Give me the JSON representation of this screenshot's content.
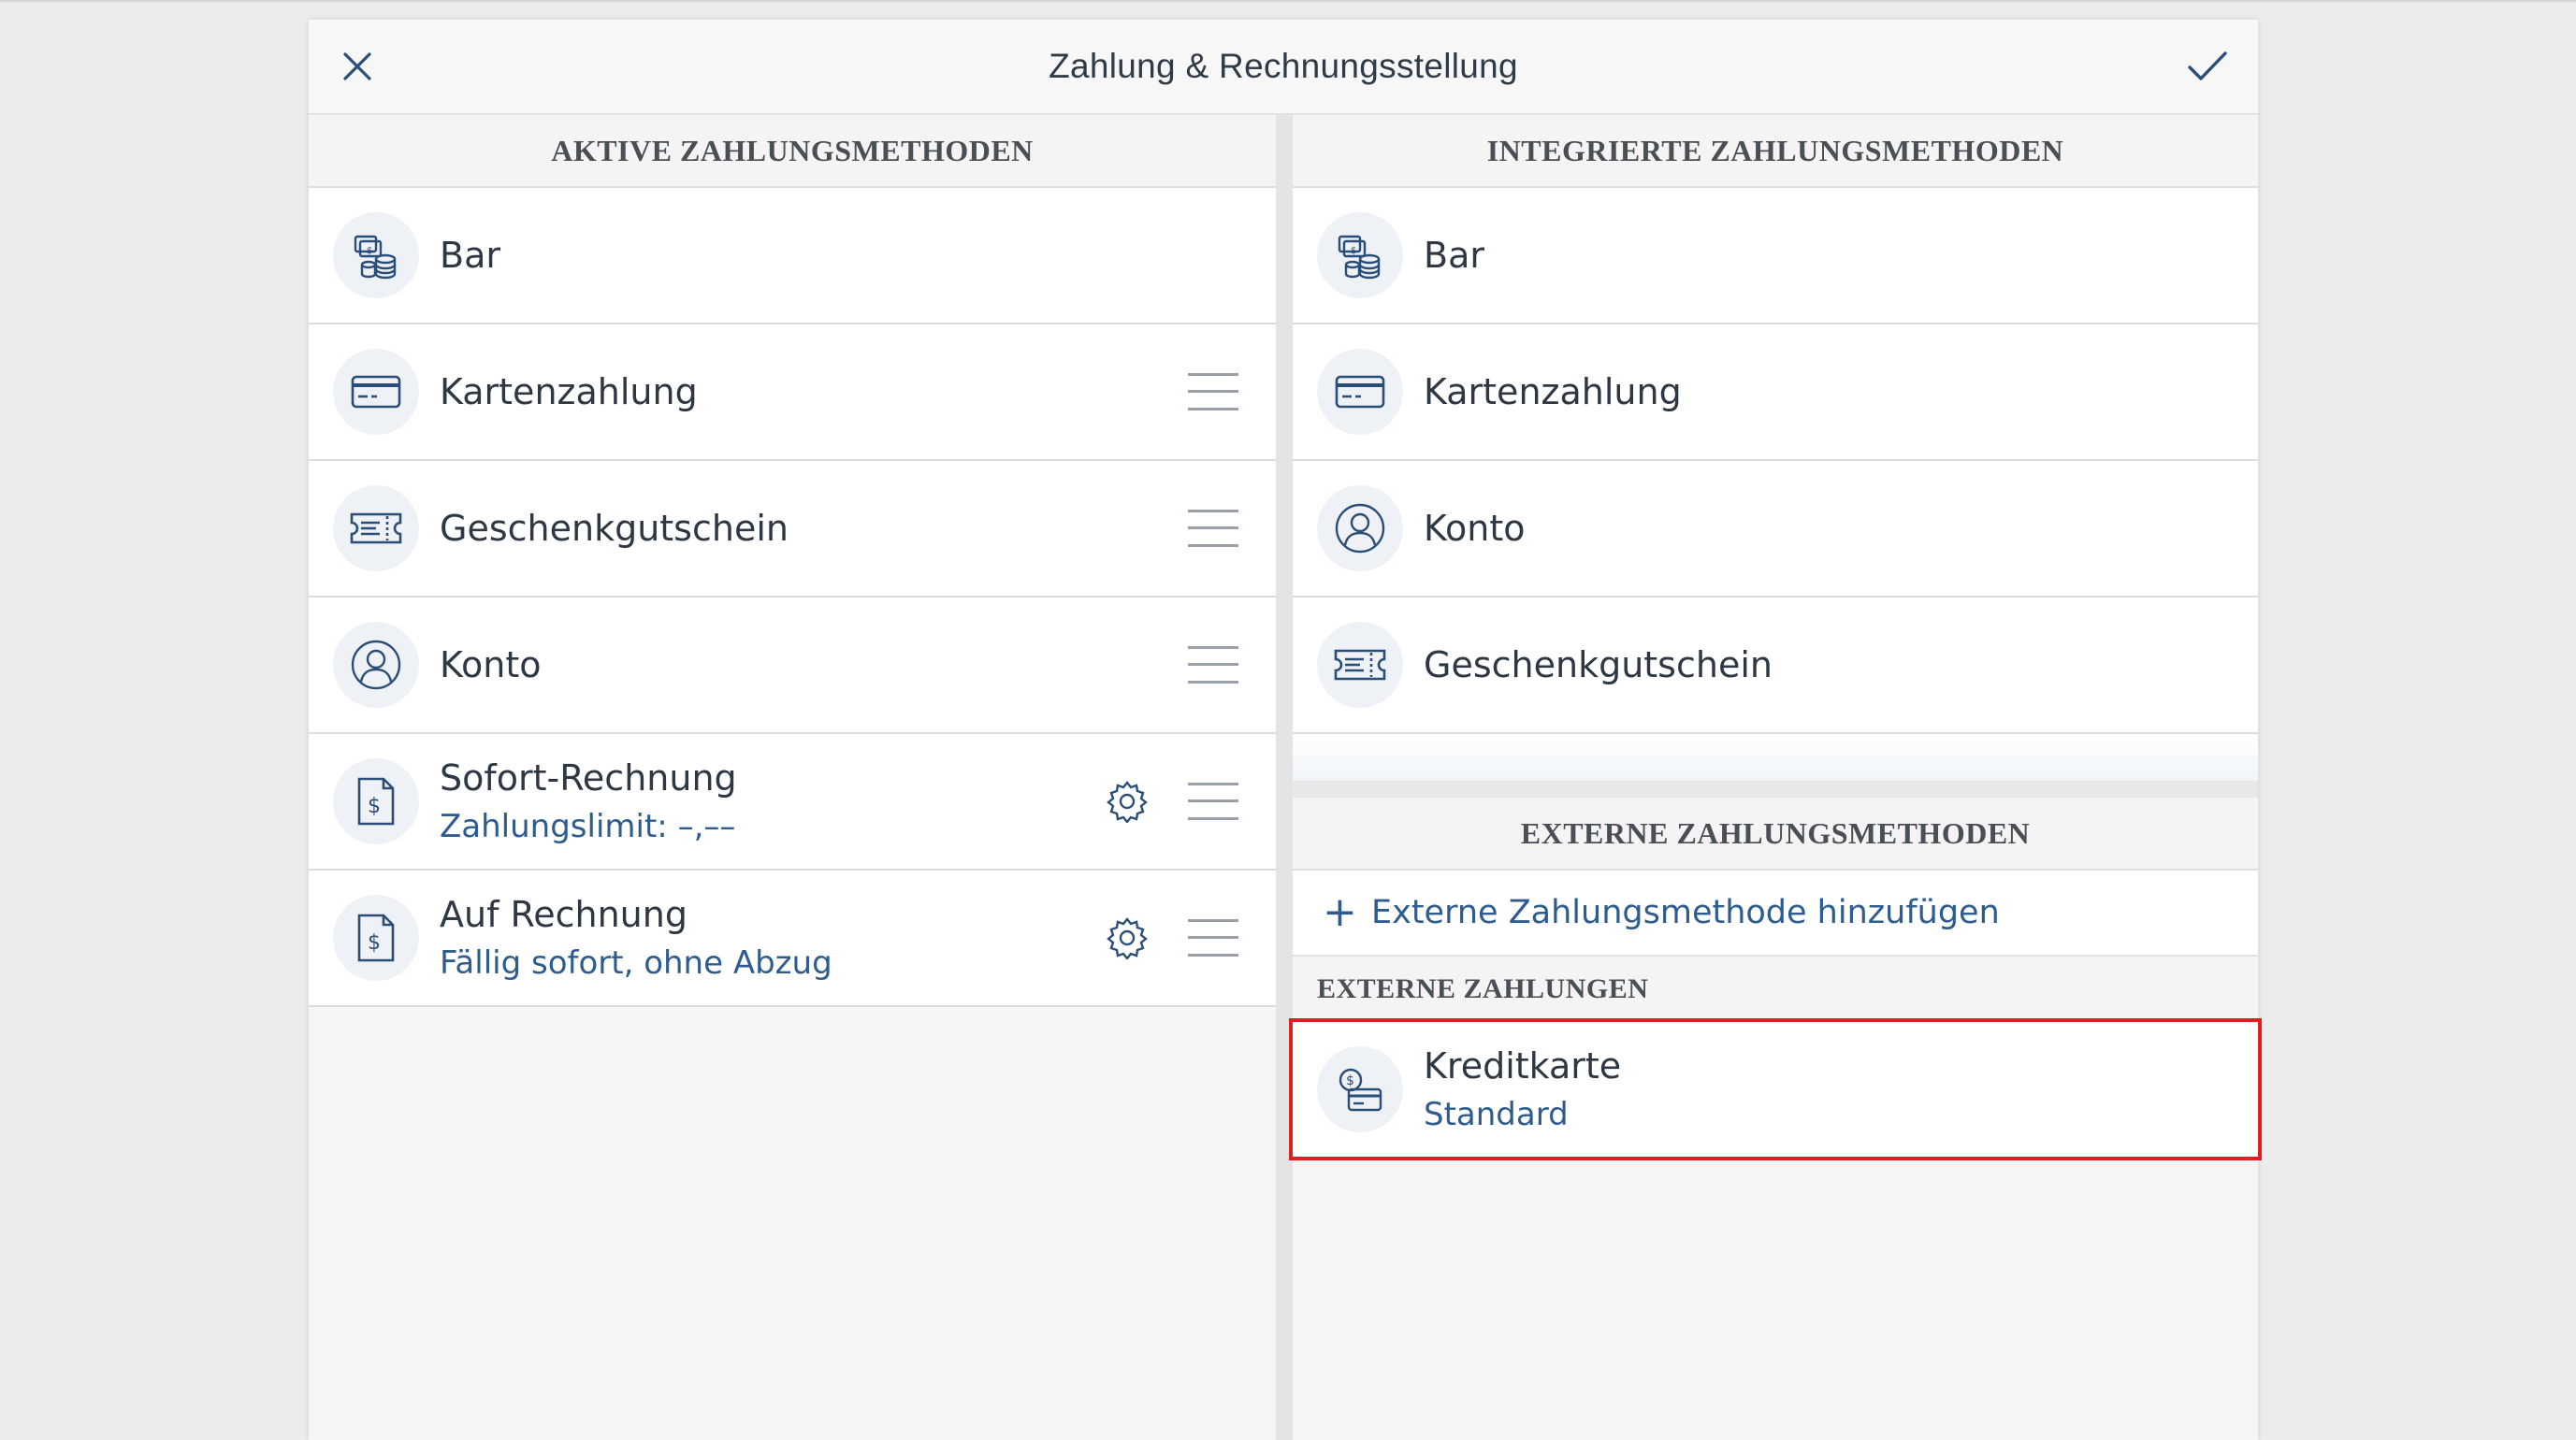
{
  "window": {
    "title": "Zahlung & Rechnungsstellung",
    "close_icon": "close-icon",
    "confirm_icon": "checkmark-icon"
  },
  "left_panel": {
    "header": "AKTIVE ZAHLUNGSMETHODEN",
    "items": [
      {
        "title": "Bar",
        "subtitle": "",
        "icon": "cash-icon",
        "draggable": false,
        "settings": false
      },
      {
        "title": "Kartenzahlung",
        "subtitle": "",
        "icon": "card-icon",
        "draggable": true,
        "settings": false
      },
      {
        "title": "Geschenkgutschein",
        "subtitle": "",
        "icon": "voucher-icon",
        "draggable": true,
        "settings": false
      },
      {
        "title": "Konto",
        "subtitle": "",
        "icon": "user-icon",
        "draggable": true,
        "settings": false
      },
      {
        "title": "Sofort-Rechnung",
        "subtitle": "Zahlungslimit: –,––",
        "icon": "invoice-icon",
        "draggable": true,
        "settings": true
      },
      {
        "title": "Auf Rechnung",
        "subtitle": "Fällig sofort, ohne Abzug",
        "icon": "invoice-icon",
        "draggable": true,
        "settings": true
      }
    ]
  },
  "right_panel": {
    "header": "INTEGRIERTE ZAHLUNGSMETHODEN",
    "items": [
      {
        "title": "Bar",
        "icon": "cash-icon"
      },
      {
        "title": "Kartenzahlung",
        "icon": "card-icon"
      },
      {
        "title": "Konto",
        "icon": "user-icon"
      },
      {
        "title": "Geschenkgutschein",
        "icon": "voucher-icon"
      }
    ],
    "external": {
      "header": "EXTERNE ZAHLUNGSMETHODEN",
      "add_label": "Externe Zahlungsmethode hinzufügen",
      "sub_header": "EXTERNE ZAHLUNGEN",
      "items": [
        {
          "title": "Kreditkarte",
          "subtitle": "Standard",
          "icon": "credit-card-payment-icon",
          "highlighted": true
        }
      ]
    }
  },
  "colors": {
    "accent": "#2f5c8e",
    "highlight": "#e02020",
    "icon_stroke": "#2b4e79"
  }
}
